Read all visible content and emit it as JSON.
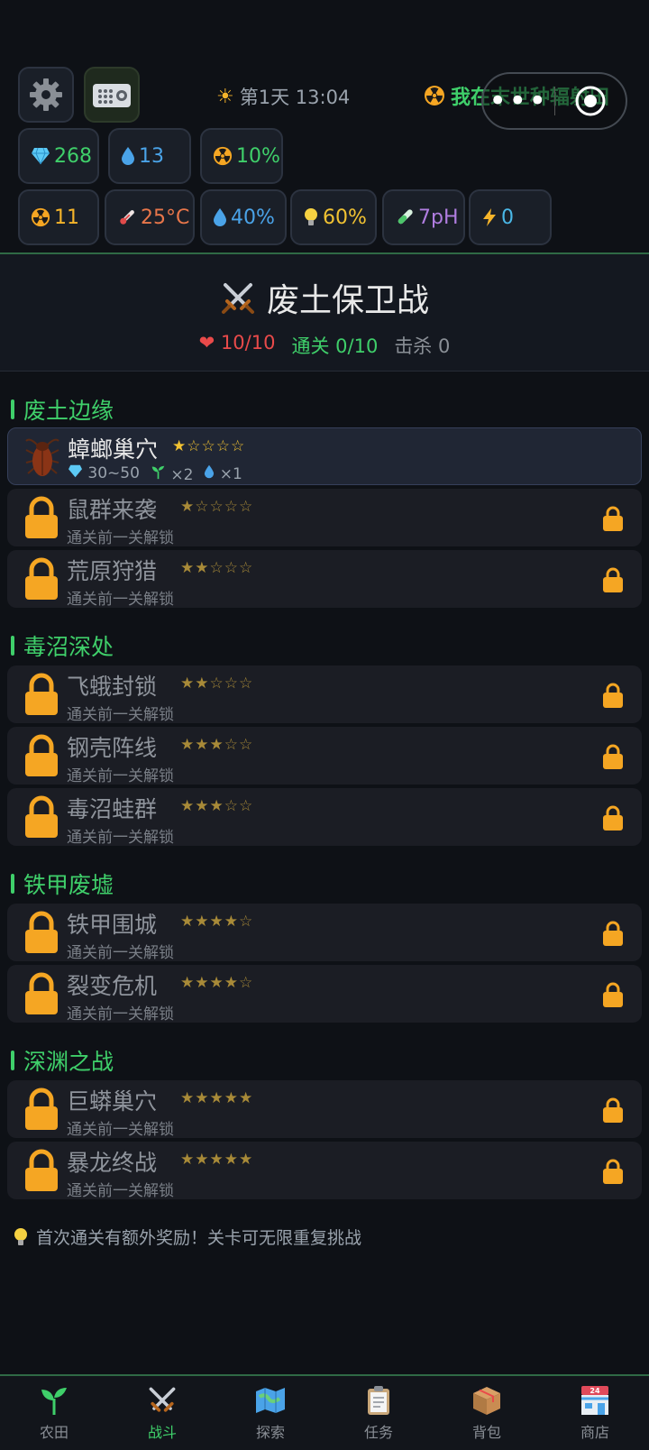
{
  "top": {
    "clock": "第1天 13:04",
    "game_title": "我在末世种辐射田",
    "menu_dots": "•••"
  },
  "resources_row1": [
    {
      "icon": "diamond-icon",
      "value": "268",
      "color": "#3fcf6a"
    },
    {
      "icon": "water-drop-icon",
      "value": "13",
      "color": "#4aa3e8"
    },
    {
      "icon": "radiation-icon",
      "value": "10%",
      "color": "#3fcf6a"
    }
  ],
  "resources_row2": [
    {
      "icon": "radiation-icon",
      "value": "11",
      "color": "#f5b42a"
    },
    {
      "icon": "thermometer-icon",
      "value": "25°C",
      "color": "#e8764a"
    },
    {
      "icon": "water-drop-icon",
      "value": "40%",
      "color": "#4aa3e8"
    },
    {
      "icon": "lightbulb-icon",
      "value": "60%",
      "color": "#f1c232"
    },
    {
      "icon": "test-tube-icon",
      "value": "7pH",
      "color": "#b07de0"
    },
    {
      "icon": "lightning-icon",
      "value": "0",
      "color": "#4ab8e8"
    }
  ],
  "battle": {
    "title": "废土保卫战",
    "hp": "10/10",
    "clear": "通关 0/10",
    "kills": "击杀 0"
  },
  "zones": [
    {
      "name": "废土边缘"
    },
    {
      "name": "毒沼深处"
    },
    {
      "name": "铁甲废墟"
    },
    {
      "name": "深渊之战"
    }
  ],
  "levels": [
    {
      "name": "蟑螂巢穴",
      "stars": "★☆☆☆☆",
      "reward_gems": "30~50",
      "reward_seed": "×2",
      "reward_water": "×1"
    },
    {
      "name": "鼠群来袭",
      "stars": "★☆☆☆☆",
      "sub": "通关前一关解锁"
    },
    {
      "name": "荒原狩猎",
      "stars": "★★☆☆☆",
      "sub": "通关前一关解锁"
    },
    {
      "name": "飞蛾封锁",
      "stars": "★★☆☆☆",
      "sub": "通关前一关解锁"
    },
    {
      "name": "钢壳阵线",
      "stars": "★★★☆☆",
      "sub": "通关前一关解锁"
    },
    {
      "name": "毒沼蛙群",
      "stars": "★★★☆☆",
      "sub": "通关前一关解锁"
    },
    {
      "name": "铁甲围城",
      "stars": "★★★★☆",
      "sub": "通关前一关解锁"
    },
    {
      "name": "裂变危机",
      "stars": "★★★★☆",
      "sub": "通关前一关解锁"
    },
    {
      "name": "巨蟒巢穴",
      "stars": "★★★★★",
      "sub": "通关前一关解锁"
    },
    {
      "name": "暴龙终战",
      "stars": "★★★★★",
      "sub": "通关前一关解锁"
    }
  ],
  "tip": "首次通关有额外奖励！关卡可无限重复挑战",
  "nav": [
    {
      "label": "农田",
      "icon": "sprout-icon"
    },
    {
      "label": "战斗",
      "icon": "crossed-swords-icon"
    },
    {
      "label": "探索",
      "icon": "map-icon"
    },
    {
      "label": "任务",
      "icon": "clipboard-icon"
    },
    {
      "label": "背包",
      "icon": "package-icon"
    },
    {
      "label": "商店",
      "icon": "store-icon"
    }
  ]
}
